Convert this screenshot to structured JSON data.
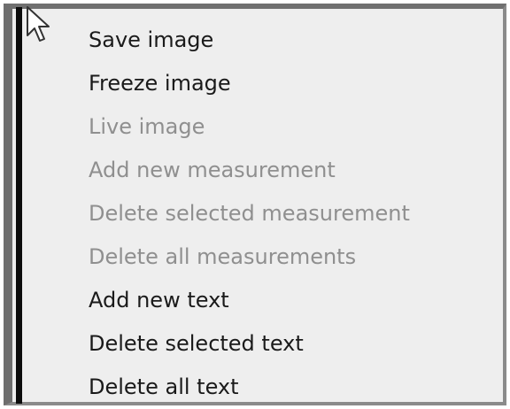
{
  "menu": {
    "items": [
      {
        "label": "Save image",
        "enabled": true
      },
      {
        "label": "Freeze image",
        "enabled": true
      },
      {
        "label": "Live image",
        "enabled": false
      },
      {
        "label": "Add new measurement",
        "enabled": false
      },
      {
        "label": "Delete selected measurement",
        "enabled": false
      },
      {
        "label": "Delete all measurements",
        "enabled": false
      },
      {
        "label": "Add new text",
        "enabled": true
      },
      {
        "label": "Delete selected text",
        "enabled": true
      },
      {
        "label": "Delete all text",
        "enabled": true
      }
    ]
  },
  "cursor": {
    "icon": "arrow-cursor-icon"
  },
  "colors": {
    "menu_background": "#eeeeee",
    "enabled_text": "#1a1a1a",
    "disabled_text": "#8f8f8f",
    "left_bar": "#0c0c0c"
  }
}
